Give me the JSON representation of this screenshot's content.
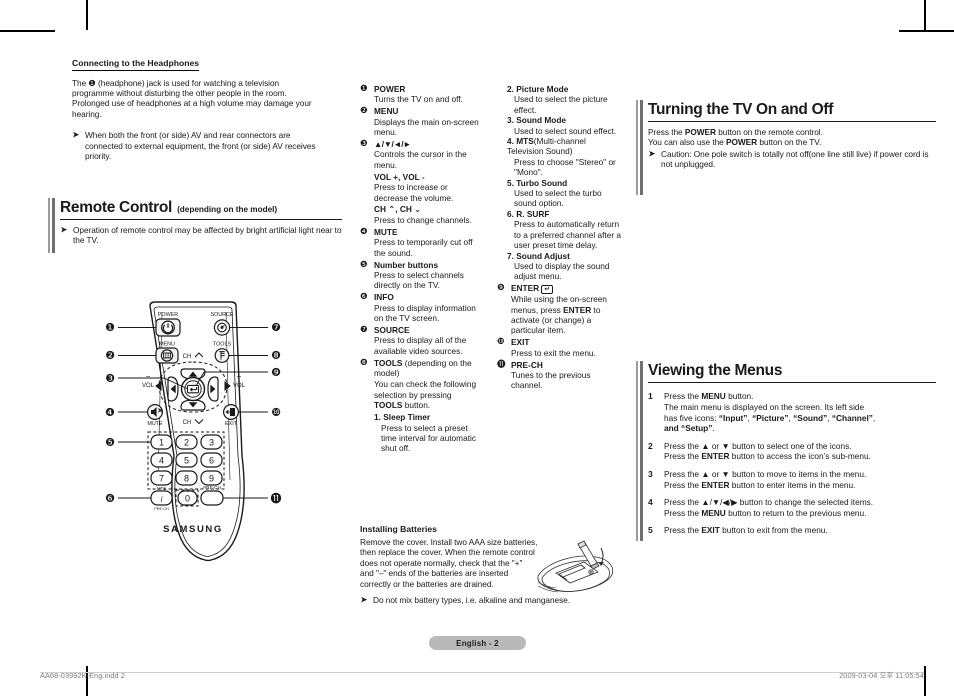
{
  "left_column": {
    "headphones": {
      "heading": "Connecting to the Headphones",
      "para1": "The ❶ (headphone) jack is used for watching a television programme without disturbing the other people in the room. Prolonged use of headphones at a high volume may damage your hearing.",
      "bullet_glyph": "➤",
      "bullet": "When both the front (or side) AV and rear connectors are connected to external equipment, the front (or side) AV receives priority."
    },
    "remote_section": {
      "title": "Remote Control",
      "subtitle": "(depending on the model)",
      "bullet_glyph": "➤",
      "bullet": "Operation of remote control may be affected by bright artificial light near to the TV."
    },
    "remote_diagram": {
      "brand": "SAMSUNG",
      "labels": {
        "power": "POWER",
        "source": "SOURCE",
        "menu": "MENU",
        "tools": "TOOLS",
        "ch_up": "CH",
        "ch_down": "CH",
        "vol_minus": "VOL",
        "vol_plus": "VOL",
        "mute": "MUTE",
        "exit": "EXIT",
        "mts": "MTS",
        "pre_ch": "PRE-CH",
        "pre_ch_btn": "PRE-CH",
        "info": "INFO",
        "minus": "−",
        "plus": "+"
      },
      "keypad": [
        "1",
        "2",
        "3",
        "4",
        "5",
        "6",
        "7",
        "8",
        "9",
        "0"
      ],
      "callouts": [
        "❶",
        "❷",
        "❸",
        "❹",
        "❺",
        "❻",
        "❼",
        "❽",
        "❾",
        "❿",
        "⓫"
      ]
    }
  },
  "middle_column": {
    "items": [
      {
        "num": "❶",
        "title": "POWER",
        "desc": "Turns the TV on and off."
      },
      {
        "num": "❷",
        "title": "MENU",
        "desc": "Displays the main on-screen menu."
      },
      {
        "num": "❸",
        "title": "▲/▼/◄/►",
        "desc": "Controls the cursor in the menu."
      },
      {
        "num": "",
        "title": "VOL +, VOL -",
        "desc": "Press to increase or decrease the volume."
      },
      {
        "num": "",
        "title": "CH ⌃, CH ⌄",
        "desc": "Press to change channels."
      },
      {
        "num": "❹",
        "title": "MUTE",
        "desc": "Press to temporarily cut off the sound."
      },
      {
        "num": "❺",
        "title": "Number buttons",
        "desc": "Press to select channels directly on the TV."
      },
      {
        "num": "❻",
        "title": "INFO",
        "desc": "Press to display information on the TV screen."
      },
      {
        "num": "❼",
        "title": "SOURCE",
        "desc": "Press to display all of the available video sources."
      },
      {
        "num": "❽",
        "title": "TOOLS",
        "title_suffix": " (depending on the model)",
        "desc": "You can check the following selection by pressing TOOLS button.",
        "desc_bold": "TOOLS"
      }
    ],
    "tools_sublist": [
      {
        "n": "1.",
        "t": "Sleep Timer",
        "d": "Press to select a preset time interval for automatic shut off."
      },
      {
        "n": "2.",
        "t": "Picture Mode",
        "d": "Used to select the picture effect."
      },
      {
        "n": "3.",
        "t": "Sound Mode",
        "d": "Used to select sound effect."
      },
      {
        "n": "4.",
        "t": "MTS",
        "t_rest": "(Multi-channel Television Sound)",
        "d": "Press to choose \"Stereo\" or \"Mono\"."
      },
      {
        "n": "5.",
        "t": "Turbo Sound",
        "d": "Used to select the turbo sound option."
      },
      {
        "n": "6.",
        "t": "R. SURF",
        "d": "Press to automatically return to a preferred channel after a user preset  time delay."
      },
      {
        "n": "7.",
        "t": "Sound Adjust",
        "d": "Used to display the sound adjust menu."
      }
    ],
    "items_tail": [
      {
        "num": "❾",
        "title": "ENTER",
        "title_icon": "⏎",
        "desc": "While using the on-screen menus, press ENTER to activate (or change) a particular item.",
        "desc_bold": "ENTER"
      },
      {
        "num": "❿",
        "title": "EXIT",
        "desc": "Press to exit the menu."
      },
      {
        "num": "⓫",
        "title": "PRE-CH",
        "desc": "Tunes to the previous channel."
      }
    ],
    "batteries": {
      "heading": "Installing Batteries",
      "para": "Remove the cover. Install two AAA size batteries, then replace the cover. When the remote control does not operate normally, check that the \"+\" and \"–\" ends of the batteries are inserted correctly or the batteries are drained.",
      "bullet_glyph": "➤",
      "bullet": "Do not mix battery types, i.e. alkaline and manganese."
    }
  },
  "right_column": {
    "power_section": {
      "title": "Turning the TV On and Off",
      "line1_a": "Press the ",
      "line1_b": "POWER",
      "line1_c": " button on the remote control.",
      "line2_a": "You can also use the ",
      "line2_b": "POWER",
      "line2_c": " button on the TV.",
      "bullet_glyph": "➤",
      "bullet": "Caution: One pole switch is totally not off(one line still live) if power cord is not unplugged."
    },
    "menus_section": {
      "title": "Viewing the Menus",
      "steps": [
        {
          "n": "1",
          "text": "Press the MENU button.\nThe main menu is displayed on the screen. Its left side has five icons: “Input”, “Picture”, “Sound”, “Channel”, and “Setup”."
        },
        {
          "n": "2",
          "text": "Press the ▲ or ▼ button to select one of the icons.\nPress the ENTER button to access the icon’s sub-menu."
        },
        {
          "n": "3",
          "text": "Press the ▲ or ▼ button to move to items in the menu.\nPress the ENTER button to enter items in the menu."
        },
        {
          "n": "4",
          "text": "Press the ▲/▼/◄/► button to change the selected items.\nPress the MENU button to return to the previous menu."
        },
        {
          "n": "5",
          "text": "Press the EXIT button to exit from the menu."
        }
      ]
    }
  },
  "footer": {
    "page_badge": "English - 2",
    "left": "AA68-03992K-Eng.indd   2",
    "right": "2009-03-04   오후 11:05:54"
  },
  "colors": {
    "section_bar_light": "#9a9a9a",
    "section_bar_dark": "#6f6f6f",
    "page_badge_bg": "#b9b9b9",
    "footer_text": "#7b7b7b",
    "rule": "#1a1a1a"
  }
}
